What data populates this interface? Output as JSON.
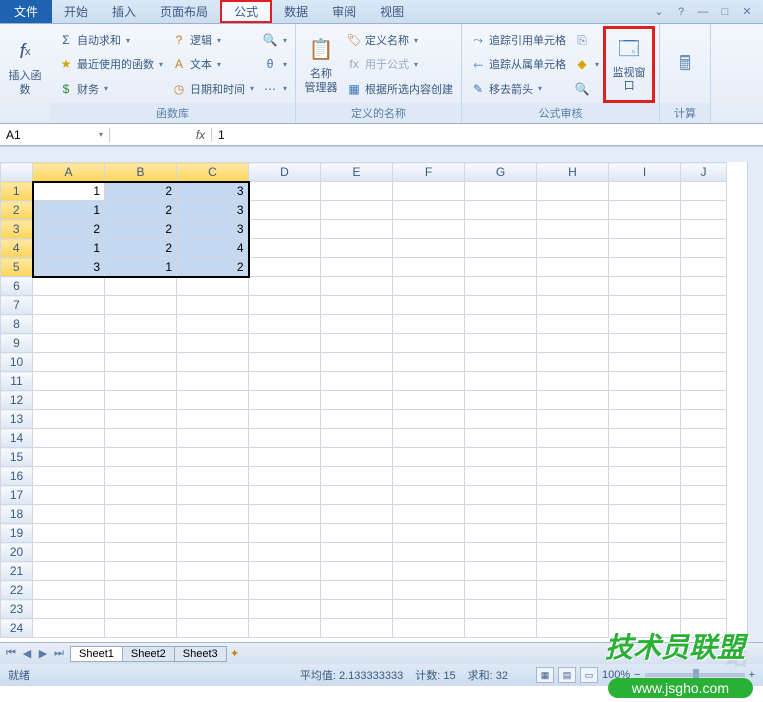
{
  "tabs": {
    "file": "文件",
    "items": [
      "开始",
      "插入",
      "页面布局",
      "公式",
      "数据",
      "审阅",
      "视图"
    ],
    "active": "公式"
  },
  "window_controls": {
    "help": "?",
    "min": "—",
    "restore": "□",
    "close": "✕",
    "caret": "⌄"
  },
  "ribbon": {
    "insert_fn": "插入函数",
    "fnlib": {
      "autosum": "自动求和",
      "recent": "最近使用的函数",
      "financial": "财务",
      "logical": "逻辑",
      "text": "文本",
      "datetime": "日期和时间",
      "label": "函数库"
    },
    "names": {
      "manager": "名称\n管理器",
      "define": "定义名称",
      "use": "用于公式",
      "create": "根据所选内容创建",
      "label": "定义的名称"
    },
    "audit": {
      "trace_prec": "追踪引用单元格",
      "trace_dep": "追踪从属单元格",
      "remove": "移去箭头",
      "watch": "监视窗口",
      "label": "公式审核"
    },
    "calc": {
      "label": "计算"
    }
  },
  "formula_bar": {
    "name_box": "A1",
    "fx": "fx",
    "value": "1"
  },
  "columns": [
    "A",
    "B",
    "C",
    "D",
    "E",
    "F",
    "G",
    "H",
    "I",
    "J"
  ],
  "rows": [
    1,
    2,
    3,
    4,
    5,
    6,
    7,
    8,
    9,
    10,
    11,
    12,
    13,
    14,
    15,
    16,
    17,
    18,
    19,
    20,
    21,
    22,
    23,
    24
  ],
  "grid_data": [
    [
      1,
      2,
      3
    ],
    [
      1,
      2,
      3
    ],
    [
      2,
      2,
      3
    ],
    [
      1,
      2,
      4
    ],
    [
      3,
      1,
      2
    ]
  ],
  "sheets": {
    "tabs": [
      "Sheet1",
      "Sheet2",
      "Sheet3"
    ],
    "active": "Sheet1"
  },
  "status": {
    "ready": "就绪",
    "avg_label": "平均值:",
    "avg": "2.133333333",
    "count_label": "计数:",
    "count": "15",
    "sum_label": "求和:",
    "sum": "32",
    "zoom": "100%"
  },
  "watermark": {
    "brand": "技术员联盟",
    "url": "www.jsgho.com"
  },
  "chart_data": {
    "type": "table",
    "columns": [
      "A",
      "B",
      "C"
    ],
    "rows": [
      [
        1,
        2,
        3
      ],
      [
        1,
        2,
        3
      ],
      [
        2,
        2,
        3
      ],
      [
        1,
        2,
        4
      ],
      [
        3,
        1,
        2
      ]
    ]
  }
}
